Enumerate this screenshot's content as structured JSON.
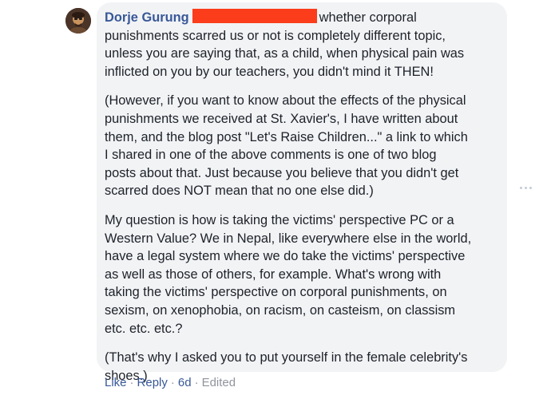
{
  "comment": {
    "author": "Dorje Gurung",
    "paragraphs": [
      [
        "whether corporal",
        "punishments scarred us or not is completely different topic,",
        "unless you are saying that, as a child, when physical pain was",
        "inflicted on you by our teachers, you didn't mind it THEN!"
      ],
      [
        "(However, if you want to know about the effects of the physical",
        "punishments we received at St. Xavier's, I have written about",
        "them, and the blog post \"Let's Raise Children...\" a link to which",
        "I shared in one of the above comments is one of two blog",
        "posts about that. Just because you believe that you didn't get",
        "scarred does NOT mean that no one else did.)"
      ],
      [
        "My question is how is taking the victims' perspective PC or a",
        "Western Value? We in Nepal, like everywhere else in the world,",
        "have a legal system where we do take the victims' perspective",
        "as well as those of others, for example. What's wrong with",
        "taking the victims' perspective on corporal punishments, on",
        "sexism, on xenophobia, on racism, on casteism, on classism",
        "etc. etc. etc.?"
      ],
      [
        "(That's why I asked you to put yourself in the female celebrity's",
        "shoes.)"
      ]
    ]
  },
  "actions": {
    "like": "Like",
    "reply": "Reply",
    "time": "6d",
    "edited": "Edited",
    "separator": "·"
  },
  "icons": {
    "more": "more-options-icon",
    "avatar": "user-avatar"
  },
  "colors": {
    "author": "#385898",
    "bubble": "#f2f3f5",
    "redaction": "#fb3d1b",
    "meta": "#90949c"
  }
}
